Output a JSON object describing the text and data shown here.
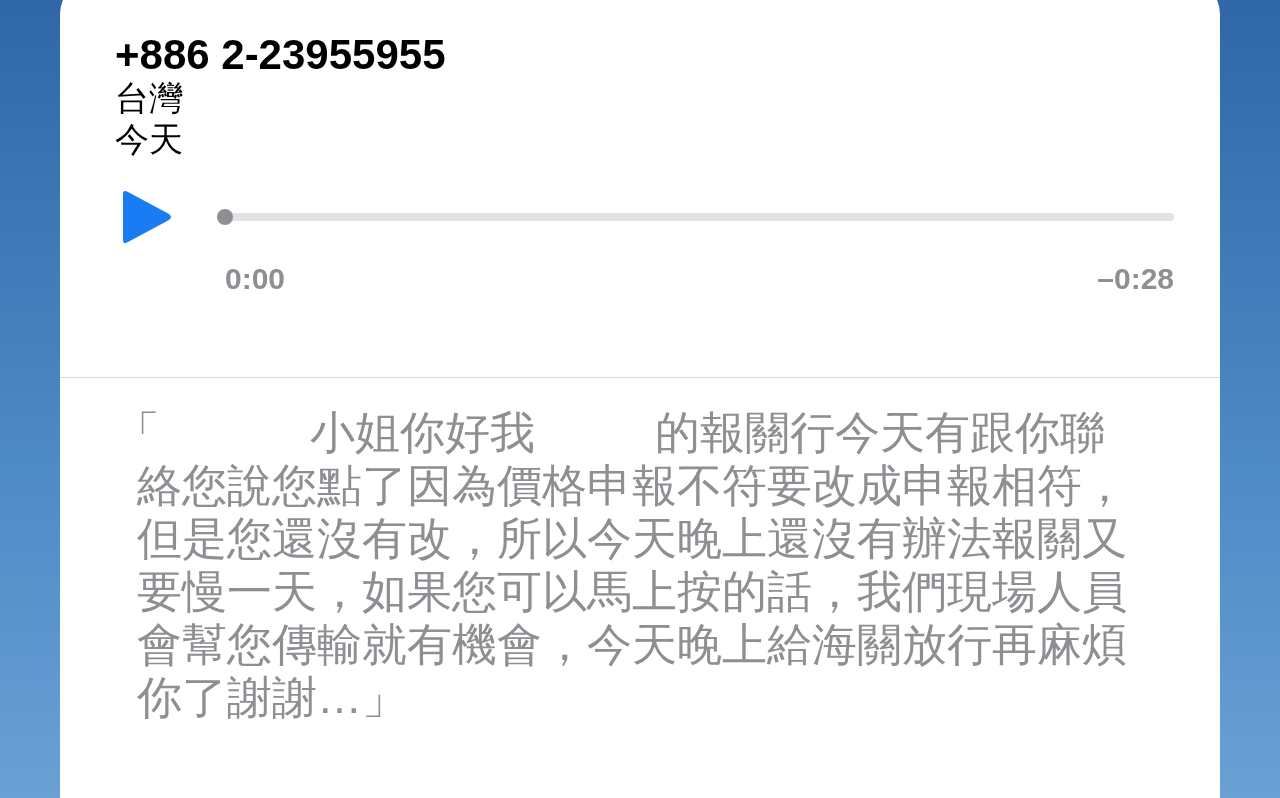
{
  "voicemail": {
    "caller": "+886 2-23955955",
    "location": "台灣",
    "date": "今天"
  },
  "player": {
    "playing": false,
    "level": 0,
    "elapsed": "0:00",
    "remaining": "–0:28"
  },
  "transcript": [
    {
      "kind": "text",
      "text": "「"
    },
    {
      "kind": "redacted"
    },
    {
      "kind": "text",
      "text": "小姐你好我"
    },
    {
      "kind": "redacted"
    },
    {
      "kind": "text",
      "text": "的報關行今天有跟你聯絡您說您點了因為價格申報不符要改成申報相符，但是您還沒有改，所以今天晚上還沒有辦法報關又要慢一天，如果您可以馬上按的話，我們現場人員會幫您傳輸就有機會，今天晚上給海關放行再麻煩你了謝謝…」"
    }
  ]
}
